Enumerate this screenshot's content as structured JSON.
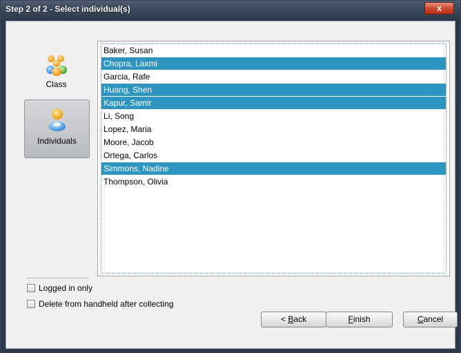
{
  "window": {
    "title": "Step 2 of 2 - Select individual(s)",
    "close_label": "x"
  },
  "nav": {
    "class_label": "Class",
    "individuals_label": "Individuals"
  },
  "students": [
    {
      "name": "Baker, Susan",
      "selected": false
    },
    {
      "name": "Chopra, Laxmi",
      "selected": true
    },
    {
      "name": "Garcia, Rafe",
      "selected": false
    },
    {
      "name": "Huang, Shen",
      "selected": true
    },
    {
      "name": "Kapur, Samir",
      "selected": true
    },
    {
      "name": "Li, Song",
      "selected": false
    },
    {
      "name": "Lopez, Maria",
      "selected": false
    },
    {
      "name": "Moore, Jacob",
      "selected": false
    },
    {
      "name": "Ortega, Carlos",
      "selected": false
    },
    {
      "name": "Simmons, Nadine",
      "selected": true
    },
    {
      "name": "Thompson, Olivia",
      "selected": false
    }
  ],
  "options": {
    "logged_in_only": {
      "label": "Logged in only",
      "checked": false
    },
    "delete_after": {
      "label": "Delete from handheld after collecting",
      "checked": false
    }
  },
  "buttons": {
    "back": {
      "prefix": "< ",
      "mnemonic": "B",
      "rest": "ack"
    },
    "finish": {
      "prefix": "",
      "mnemonic": "F",
      "rest": "inish"
    },
    "cancel": {
      "prefix": "",
      "mnemonic": "C",
      "rest": "ancel"
    }
  },
  "colors": {
    "selection": "#2f94bf",
    "titlebar": "#3c4a5f",
    "close": "#cc4a32"
  },
  "icons": {
    "class": "group-people-icon",
    "individuals": "single-person-icon"
  }
}
